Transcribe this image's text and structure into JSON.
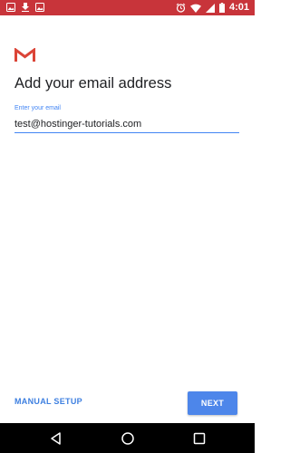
{
  "status_bar": {
    "time": "4:01",
    "color": "#c8343a",
    "left_icons": [
      "image-icon",
      "download-icon",
      "image-icon"
    ],
    "right_icons": [
      "alarm-icon",
      "wifi-icon",
      "signal-icon",
      "battery-icon"
    ]
  },
  "app": {
    "logo": "gmail-logo-icon",
    "title": "Add your email address",
    "email_label": "Enter your email",
    "email_value": "test@hostinger-tutorials.com",
    "accent": "#4285f4"
  },
  "actions": {
    "manual_setup_label": "MANUAL SETUP",
    "next_label": "NEXT"
  },
  "nav_bar": {
    "icons": [
      "back-icon",
      "home-icon",
      "recents-icon"
    ]
  }
}
